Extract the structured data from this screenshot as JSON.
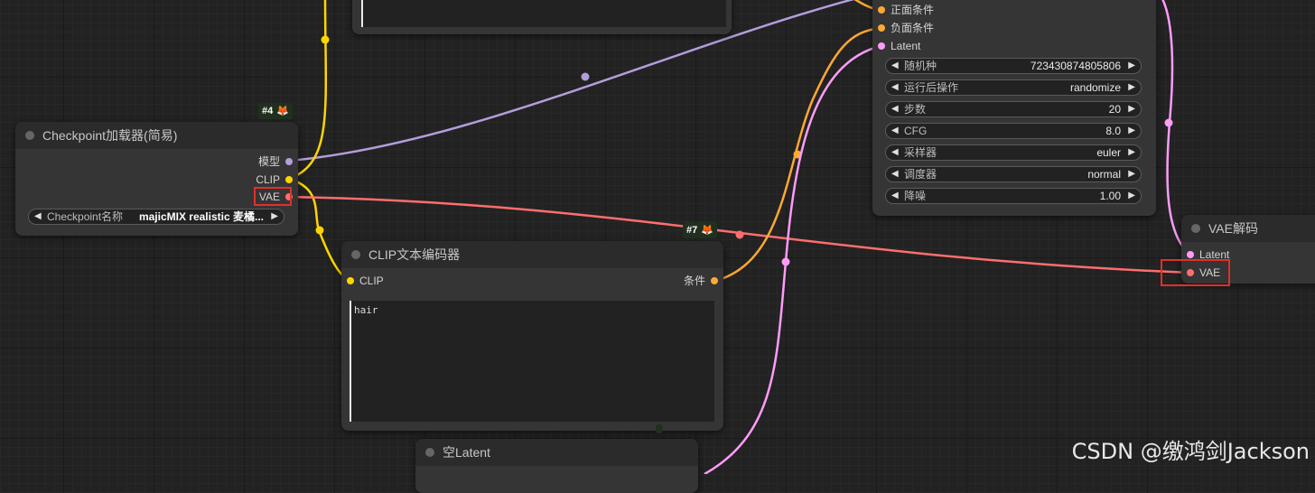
{
  "nodes": {
    "checkpoint": {
      "title": "Checkpoint加载器(简易)",
      "badge_id": "#4",
      "outputs": [
        "模型",
        "CLIP",
        "VAE"
      ],
      "widget_label": "Checkpoint名称",
      "widget_value": "majicMIX realistic 麦橘..."
    },
    "ksampler": {
      "inputs": [
        "正面条件",
        "负面条件",
        "Latent"
      ],
      "widgets": [
        {
          "label": "随机种",
          "value": "723430874805806"
        },
        {
          "label": "运行后操作",
          "value": "randomize"
        },
        {
          "label": "步数",
          "value": "20"
        },
        {
          "label": "CFG",
          "value": "8.0"
        },
        {
          "label": "采样器",
          "value": "euler"
        },
        {
          "label": "调度器",
          "value": "normal"
        },
        {
          "label": "降噪",
          "value": "1.00"
        }
      ]
    },
    "clip_encoder": {
      "title": "CLIP文本编码器",
      "badge_id": "#7",
      "input": "CLIP",
      "output": "条件",
      "text": "hair"
    },
    "vae_decode": {
      "title": "VAE解码",
      "inputs": [
        "Latent",
        "VAE"
      ]
    },
    "empty_latent": {
      "title": "空Latent"
    }
  },
  "watermark": "CSDN @缴鸿剑Jackson",
  "colors": {
    "model": "#b39ddb",
    "clip": "#ffd500",
    "vae": "#ff6e6e",
    "conditioning": "#ffa931",
    "latent": "#ff9cf9",
    "highlight": "#e0302a"
  }
}
